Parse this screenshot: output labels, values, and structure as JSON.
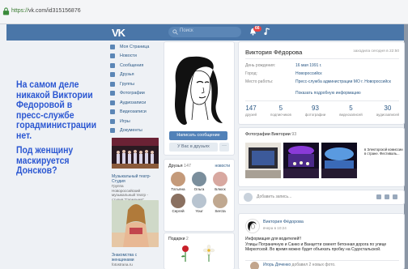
{
  "browser": {
    "url_scheme": "https://",
    "url_host": "vk.com/id315156876"
  },
  "topbar": {
    "logo": "VK",
    "search_placeholder": "Поиск",
    "notifications_count": "66"
  },
  "caption": {
    "para1": "На самом деле никакой Виктории Федоровой в пресс-службе горадминистрации нет.",
    "para2": "Под женщину маскируется Донсков?"
  },
  "menu": [
    "Моя Страница",
    "Новости",
    "Сообщения",
    "Друзья",
    "Группы",
    "Фотографии",
    "Аудиозаписи",
    "Видеозаписи",
    "Игры",
    "Документы"
  ],
  "ads": [
    {
      "title": "Музыкальный театр-Студия",
      "sub": "Группа",
      "desc": "Новороссийский музыкальный театр - студия \"Гармония\""
    },
    {
      "title": "Знакомства с женщинами",
      "sub": "fotostrana.ru"
    }
  ],
  "avatar_actions": {
    "message": "Написать сообщение",
    "friends": "У Вас в друзьях",
    "more": "···"
  },
  "friends": {
    "title": "Друзья",
    "count": "147",
    "new_label": "новости",
    "items": [
      "Татьяна",
      "Ольга",
      "Блюск",
      "Сергей",
      "Your",
      "Serсta"
    ]
  },
  "gifts": {
    "title": "Подарки",
    "count": "2"
  },
  "profile": {
    "name": "Виктория Фёдорова",
    "online": "заходила сегодня в 22:50",
    "rows": [
      {
        "k": "День рождения:",
        "v": "16 мая 1991 г."
      },
      {
        "k": "Город:",
        "v": "Новороссийск"
      },
      {
        "k": "Место работы:",
        "v": "Пресс-служба администрации МО г. Новороссийск"
      }
    ],
    "more": "Показать подробную информацию",
    "counters": [
      {
        "num": "147",
        "lbl": "друзей"
      },
      {
        "num": "5",
        "lbl": "подписчиков"
      },
      {
        "num": "93",
        "lbl": "фотографии"
      },
      {
        "num": "5",
        "lbl": "видеозаписей"
      },
      {
        "num": "30",
        "lbl": "аудиозаписей"
      }
    ]
  },
  "photos": {
    "title": "Фотографии Виктории",
    "count": "93",
    "caption": "в Электорской комиссии в стране. Фестиваль..."
  },
  "new_post": {
    "placeholder": "Добавить запись..."
  },
  "post": {
    "author": "Виктория Фёдорова",
    "date": "вчера в 10:24",
    "line1": "Информация для водителей!!",
    "line2": "Улицы Пограничную и Санко и Ванцетти сменят бетонная дорога по улице",
    "line3": "Мирхотской. Во время можно будет объехать пробку на Судостальской.",
    "comment_author": "Игорь Дяченко",
    "comment_text": "добавил 2 новых фото."
  }
}
